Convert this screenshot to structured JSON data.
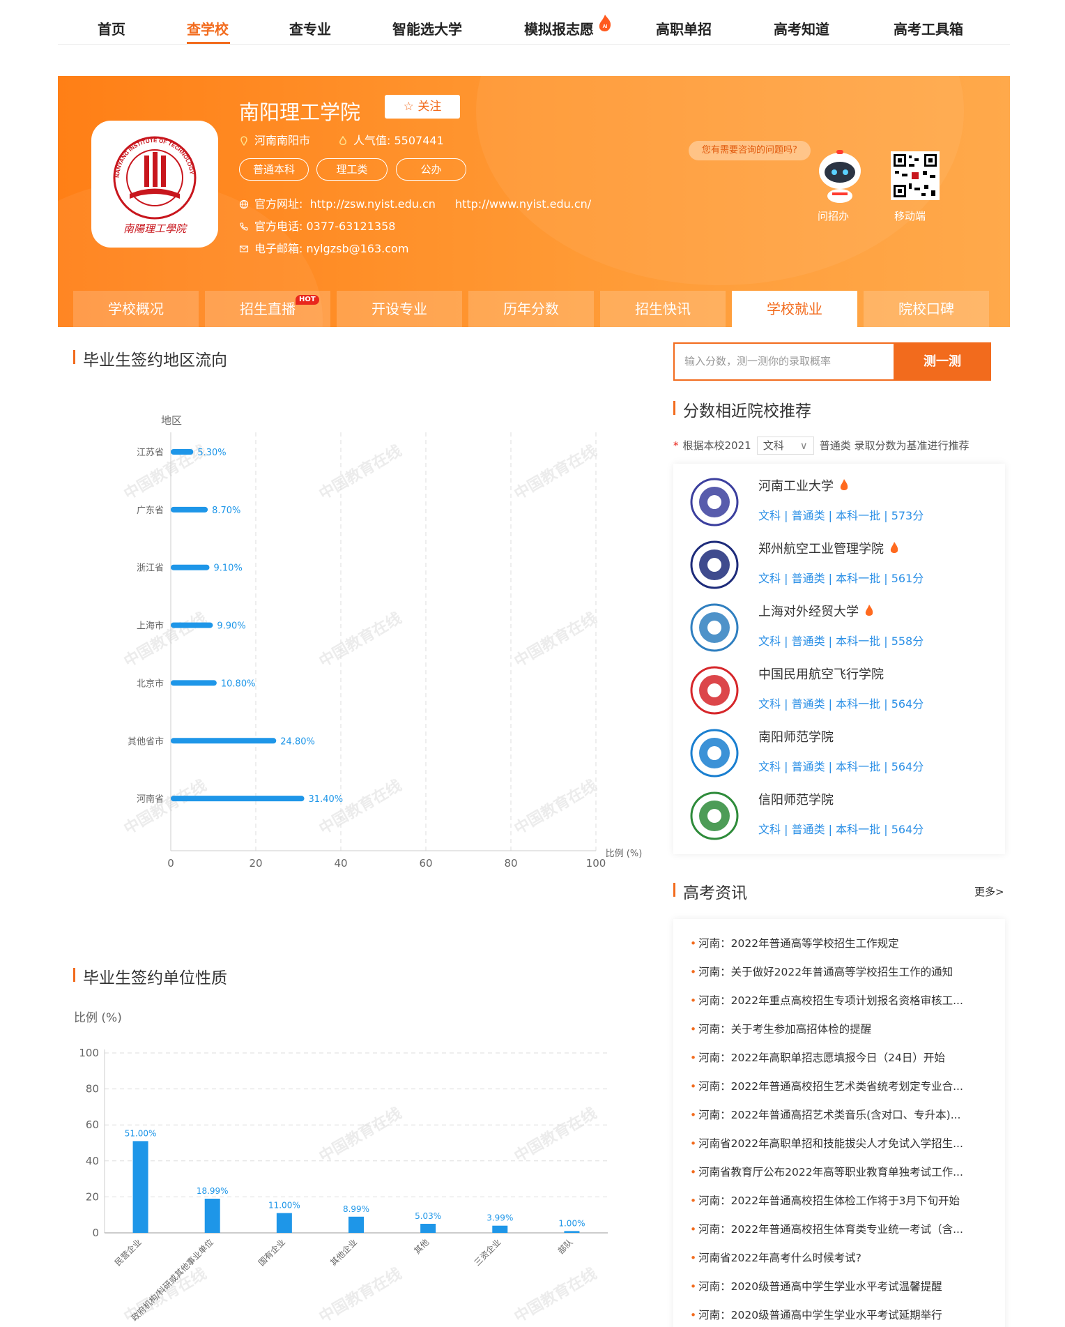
{
  "topnav": {
    "items": [
      "首页",
      "查学校",
      "查专业",
      "智能选大学",
      "模拟报志愿",
      "高职单招",
      "高考知道",
      "高考工具箱"
    ],
    "active": "查学校",
    "ai_badge": "AI"
  },
  "school": {
    "name": "南阳理工学院",
    "follow_label": "☆ 关注",
    "location": "河南南阳市",
    "popularity_label": "人气值:",
    "popularity_value": "5507441",
    "tags": [
      "普通本科",
      "理工类",
      "公办"
    ],
    "website_label": "官方网址:",
    "website_1": "http://zsw.nyist.edu.cn",
    "website_2": "http://www.nyist.edu.cn/",
    "phone_label": "官方电话:",
    "phone": "0377-63121358",
    "email_label": "电子邮箱:",
    "email": "nylgzsb@163.com",
    "logo_text_en": "NANYANG INSTITUTE OF TECHNOLOGY",
    "logo_text_cn": "南陽理工學院",
    "consult_bubble": "您有需要咨询的问题吗?",
    "ask_label": "问招办",
    "mobile_label": "移动端"
  },
  "tabs": {
    "items": [
      "学校概况",
      "招生直播",
      "开设专业",
      "历年分数",
      "招生快讯",
      "学校就业",
      "院校口碑"
    ],
    "active": "学校就业",
    "hot": "HOT"
  },
  "region_section": {
    "title": "毕业生签约地区流向"
  },
  "unit_section": {
    "title": "毕业生签约单位性质"
  },
  "watermark": "中国教育在线",
  "chart_data": [
    {
      "type": "bar",
      "orientation": "horizontal",
      "title": "",
      "ylabel": "地区",
      "xlabel": "比例 (%)",
      "xlim": [
        0,
        100
      ],
      "xticks": [
        "0",
        "20",
        "40",
        "60",
        "80",
        "100"
      ],
      "categories": [
        "江苏省",
        "广东省",
        "浙江省",
        "上海市",
        "北京市",
        "其他省市",
        "河南省"
      ],
      "values": [
        5.3,
        8.7,
        9.1,
        9.9,
        10.8,
        24.8,
        31.4
      ],
      "labels": [
        "5.30%",
        "8.70%",
        "9.10%",
        "9.90%",
        "10.80%",
        "24.80%",
        "31.40%"
      ],
      "color": "#1e96e8",
      "grid": true
    },
    {
      "type": "bar",
      "orientation": "vertical",
      "title": "",
      "ylabel": "比例 (%)",
      "ylim": [
        0,
        100
      ],
      "yticks": [
        "0",
        "20",
        "40",
        "60",
        "80",
        "100"
      ],
      "categories": [
        "民营企业",
        "政府机构/科研或其他事业单位",
        "国有企业",
        "其他企业",
        "其他",
        "三资企业",
        "部队"
      ],
      "values": [
        51.0,
        18.99,
        11.0,
        8.99,
        5.03,
        3.99,
        1.0
      ],
      "labels": [
        "51.00%",
        "18.99%",
        "11.00%",
        "8.99%",
        "5.03%",
        "3.99%",
        "1.00%"
      ],
      "color": "#1e96e8",
      "grid": true
    }
  ],
  "probe": {
    "placeholder": "输入分数，测一测你的录取概率",
    "button": "测一测"
  },
  "recommend": {
    "title": "分数相近院校推荐",
    "filter_prefix": "根据本校2021",
    "filter_select": "文科",
    "filter_suffix": "普通类 录取分数为基准进行推荐",
    "items": [
      {
        "name": "河南工业大学",
        "hot": true,
        "meta": "文科 |  普通类 |  本科一批 |  573分",
        "color": "#3b3f9e"
      },
      {
        "name": "郑州航空工业管理学院",
        "hot": true,
        "meta": "文科 |  普通类 |  本科一批 |  561分",
        "color": "#1d2b7a"
      },
      {
        "name": "上海对外经贸大学",
        "hot": true,
        "meta": "文科 |  普通类 |  本科一批 |  558分",
        "color": "#2f7fc0"
      },
      {
        "name": "中国民用航空飞行学院",
        "hot": false,
        "meta": "文科 |  普通类 |  本科一批 |  564分",
        "color": "#d6262a"
      },
      {
        "name": "南阳师范学院",
        "hot": false,
        "meta": "文科 |  普通类 |  本科一批 |  564分",
        "color": "#1a7fd0"
      },
      {
        "name": "信阳师范学院",
        "hot": false,
        "meta": "文科 |  普通类 |  本科一批 |  564分",
        "color": "#2e8b3a"
      }
    ]
  },
  "news": {
    "title": "高考资讯",
    "more": "更多>",
    "items": [
      "河南：2022年普通高等学校招生工作规定",
      "河南：关于做好2022年普通高等学校招生工作的通知",
      "河南：2022年重点高校招生专项计划报名资格审核工...",
      "河南：关于考生参加高招体检的提醒",
      "河南：2022年高职单招志愿填报今日（24日）开始",
      "河南：2022年普通高校招生艺术类省统考划定专业合...",
      "河南：2022年普通高招艺术类音乐(含对口、专升本)...",
      "河南省2022年高职单招和技能拔尖人才免试入学招生...",
      "河南省教育厅公布2022年高等职业教育单独考试工作...",
      "河南：2022年普通高校招生体检工作将于3月下旬开始",
      "河南：2022年普通高校招生体育类专业统一考试（含...",
      "河南省2022年高考什么时候考试?",
      "河南：2020级普通高中学生学业水平考试温馨提醒",
      "河南：2020级普通高中学生学业水平考试延期举行"
    ]
  }
}
